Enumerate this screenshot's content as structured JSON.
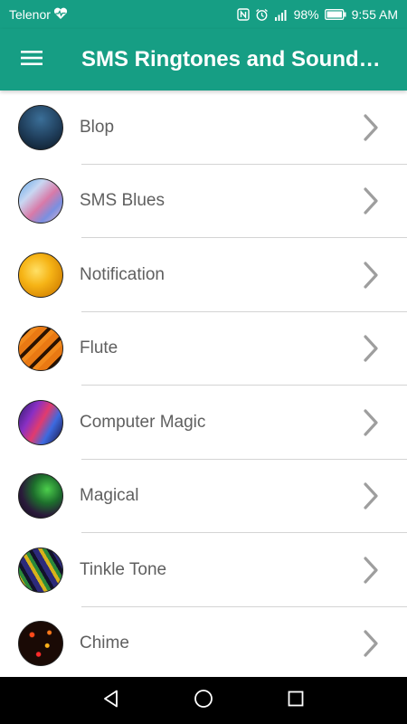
{
  "status_bar": {
    "carrier": "Telenor",
    "battery": "98%",
    "time": "9:55 AM"
  },
  "app_bar": {
    "title": "SMS Ringtones and Sounds f..."
  },
  "ringtones": [
    {
      "label": "Blop"
    },
    {
      "label": "SMS Blues"
    },
    {
      "label": "Notification"
    },
    {
      "label": "Flute"
    },
    {
      "label": "Computer Magic"
    },
    {
      "label": "Magical"
    },
    {
      "label": "Tinkle Tone"
    },
    {
      "label": "Chime"
    }
  ],
  "colors": {
    "primary": "#169e84",
    "text": "#5f5f5f",
    "chevron": "#9e9e9e",
    "nav_bar": "#000000"
  }
}
